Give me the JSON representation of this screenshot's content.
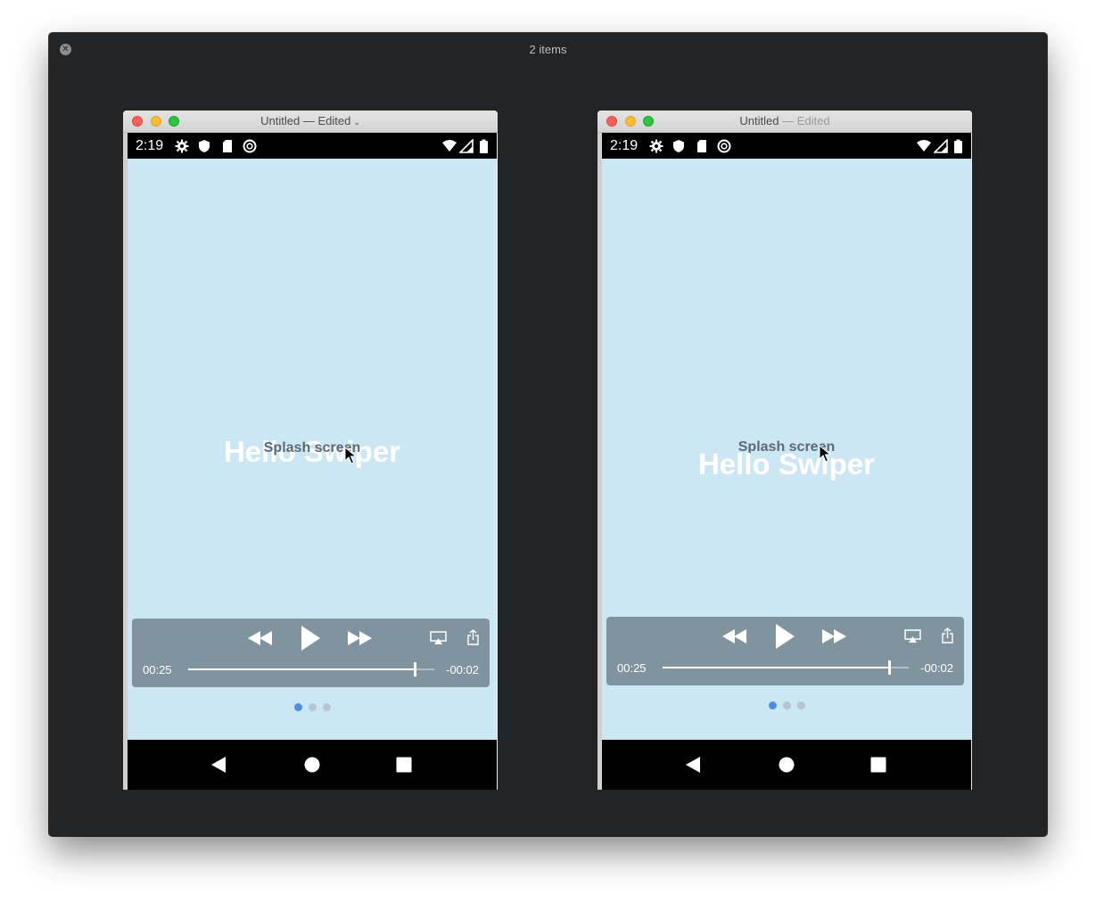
{
  "viewer": {
    "title": "2 items",
    "close_glyph": "✕"
  },
  "windows": [
    {
      "title": "Untitled",
      "edited": " — Edited",
      "has_chevron": true,
      "status_time": "2:19",
      "hello_text": "Hello Swiper",
      "splash_text": "Splash screen",
      "player": {
        "current_time": "00:25",
        "remaining_time": "-00:02",
        "progress": 0.92
      },
      "page_dots": {
        "count": 3,
        "active": 0
      }
    },
    {
      "title": "Untitled",
      "edited": " — Edited",
      "has_chevron": false,
      "status_time": "2:19",
      "hello_text": "Hello Swiper",
      "splash_text": "Splash screen",
      "player": {
        "current_time": "00:25",
        "remaining_time": "-00:02",
        "progress": 0.92
      },
      "page_dots": {
        "count": 3,
        "active": 0
      }
    }
  ],
  "colors": {
    "screen_bg": "#cbe7f4",
    "player_bg": "#80949f",
    "active_dot": "#4a90e2"
  },
  "icons": {
    "status_left": [
      "settings-icon",
      "shield-icon",
      "sd-card-icon",
      "sync-icon"
    ],
    "status_right": [
      "wifi-icon",
      "signal-icon",
      "battery-icon"
    ],
    "player": [
      "rewind-icon",
      "play-icon",
      "fast-forward-icon",
      "airplay-icon",
      "share-icon"
    ],
    "nav": [
      "back-icon",
      "home-icon",
      "recents-icon"
    ]
  }
}
